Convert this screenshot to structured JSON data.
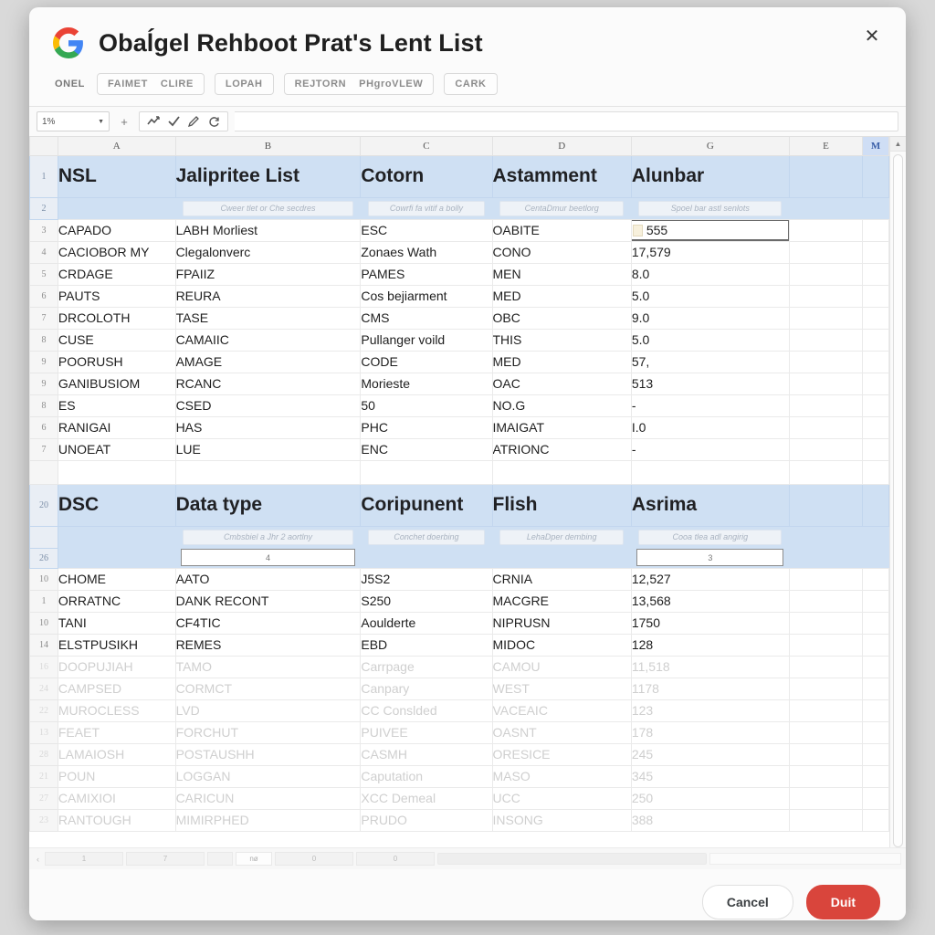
{
  "dialog": {
    "title": "Obaĺgel Rehboot Prat's Lent List",
    "close_label": "✕",
    "logo": "google-logo"
  },
  "chips": {
    "lead_label": "ONEL",
    "items": [
      {
        "labels": [
          "FAIMET",
          "CLIRE"
        ]
      },
      {
        "labels": [
          "LOPAH"
        ]
      },
      {
        "labels": [
          "REJTORN",
          "PHgroVLEW"
        ]
      },
      {
        "labels": [
          "CARK"
        ]
      }
    ]
  },
  "toolbar": {
    "select_value": "1%",
    "caret": "▼",
    "plus": "+",
    "icons": [
      "chart-icon",
      "check-icon",
      "pen-icon",
      "refresh-icon"
    ],
    "formula_value": ""
  },
  "grid": {
    "columns": [
      "A",
      "B",
      "C",
      "D",
      "G",
      "E",
      "M"
    ],
    "selected_column": "M",
    "section1": {
      "title_rownum": "1",
      "headers": [
        "NSL",
        "Jalipritee List",
        "Cotorn",
        "Astamment",
        "Alunbar"
      ],
      "ph_rownum": "2",
      "placeholders": [
        "",
        "Cweer tlet or Che secdres",
        "Cowrfi fa vitif a bolly",
        "CentaDmur beetlorg",
        "Spoel bar astl senlots"
      ],
      "rows": [
        {
          "n": "3",
          "cells": [
            "CAPADO",
            "LABH Morliest",
            "ESC",
            "OABITE",
            "555"
          ],
          "selected": true
        },
        {
          "n": "4",
          "cells": [
            "CACIOBOR MY",
            "Clegalonverc",
            "Zonaes Wath",
            "CONO",
            "17,579"
          ]
        },
        {
          "n": "5",
          "cells": [
            "CRDAGE",
            "FPAIIZ",
            "PAMES",
            "MEN",
            "8.0"
          ]
        },
        {
          "n": "6",
          "cells": [
            "PAUTS",
            "REURA",
            "Cos bejiarment",
            "MED",
            "5.0"
          ]
        },
        {
          "n": "7",
          "cells": [
            "DRCOLOTH",
            "TASE",
            "CMS",
            "OBC",
            "9.0"
          ]
        },
        {
          "n": "8",
          "cells": [
            "CUSE",
            "CAMAIIC",
            "Pullanger voild",
            "THIS",
            "5.0"
          ]
        },
        {
          "n": "9",
          "cells": [
            "POORUSH",
            "AMAGE",
            "CODE",
            "MED",
            "57,"
          ]
        },
        {
          "n": "9",
          "cells": [
            "GANIBUSIOM",
            "RCANC",
            "Morieste",
            "OAC",
            "513"
          ]
        },
        {
          "n": "8",
          "cells": [
            "ES",
            "CSED",
            "50",
            "NO.G",
            "-"
          ]
        },
        {
          "n": "6",
          "cells": [
            "RANIGAI",
            "HAS",
            "PHC",
            "IMAIGAT",
            "I.0"
          ]
        },
        {
          "n": "7",
          "cells": [
            "UNOEAT",
            "LUE",
            "ENC",
            "ATRIONC",
            "-"
          ]
        }
      ]
    },
    "section2": {
      "title_rownum": "20",
      "headers": [
        "DSC",
        "Data type",
        "Coripunent",
        "Flish",
        "Asrima"
      ],
      "ph_rownum": "26",
      "placeholders": [
        "",
        "Cmbsbiel a Jhr 2 aortlny",
        "Conchet doerbing",
        "LehaDper dembing",
        "Cooa tlea adl angirig"
      ],
      "inputs": [
        "",
        "4",
        "",
        "",
        "3"
      ],
      "rows": [
        {
          "n": "10",
          "cells": [
            "CHOME",
            "AATO",
            "J5S2",
            "CRNIA",
            "12,527"
          ]
        },
        {
          "n": "1",
          "cells": [
            "ORRATNC",
            "DANK RECONT",
            "S250",
            "MACGRE",
            "13,568"
          ]
        },
        {
          "n": "10",
          "cells": [
            "TANI",
            "CF4TIC",
            "Aoulderte",
            "NIPRUSN",
            "1750"
          ]
        },
        {
          "n": "14",
          "cells": [
            "ELSTPUSIKH",
            "REMES",
            "EBD",
            "MIDOC",
            "128"
          ]
        },
        {
          "n": "16",
          "cells": [
            "DOOPUJIAH",
            "TAMO",
            "Carrpage",
            "CAMOU",
            "11,518"
          ],
          "faded": true
        },
        {
          "n": "24",
          "cells": [
            "CAMPSED",
            "CORMCT",
            "Canpary",
            "WEST",
            "1178"
          ],
          "faded": true
        },
        {
          "n": "22",
          "cells": [
            "MUROCLESS",
            "LVD",
            "CC Conslded",
            "VACEAIC",
            "123"
          ],
          "faded": true
        },
        {
          "n": "13",
          "cells": [
            "FEAET",
            "FORCHUT",
            "PUIVEE",
            "OASNT",
            "178"
          ],
          "faded": true
        },
        {
          "n": "28",
          "cells": [
            "LAMAIOSH",
            "POSTAUSHH",
            "CASMH",
            "ORESICE",
            "245"
          ],
          "faded": true
        },
        {
          "n": "21",
          "cells": [
            "POUN",
            "LOGGAN",
            "Caputation",
            "MASO",
            "345"
          ],
          "faded": true
        },
        {
          "n": "27",
          "cells": [
            "CAMIXIOI",
            "CARICUN",
            "XCC Demeal",
            "UCC",
            "250"
          ],
          "faded": true
        },
        {
          "n": "23",
          "cells": [
            "RANTOUGH",
            "MIMIRPHED",
            "PRUDO",
            "INSONG",
            "388"
          ],
          "faded": true
        }
      ]
    }
  },
  "statusbar": {
    "nav_first": "‹",
    "tabs": [
      "1",
      "7",
      "",
      "nø",
      "0",
      "0"
    ],
    "active_tab_index": 3
  },
  "footer": {
    "cancel_label": "Cancel",
    "primary_label": "Duit",
    "primary_color": "#d9453c"
  }
}
